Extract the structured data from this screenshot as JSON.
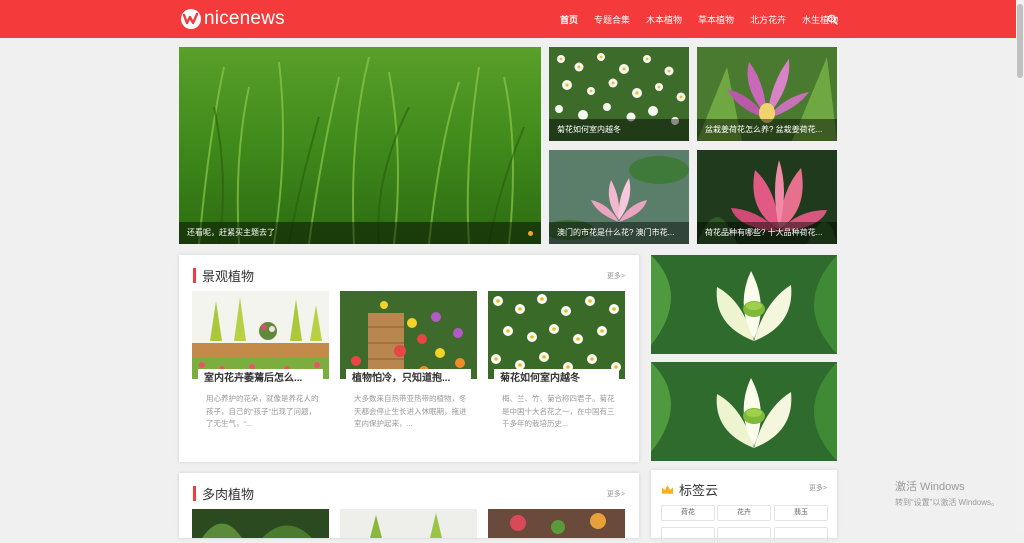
{
  "header": {
    "logo_text": "nicenews",
    "nav": [
      "首页",
      "专题合集",
      "木本植物",
      "草本植物",
      "北方花卉",
      "水生植物"
    ]
  },
  "hero": {
    "main": {
      "caption": "还看呢，赶紧买主题去了"
    },
    "grid": [
      {
        "caption": "菊花如何室内越冬"
      },
      {
        "caption": "盆栽姜荷花怎么养? 盆栽姜荷花..."
      },
      {
        "caption": "澳门的市花是什么花? 澳门市花..."
      },
      {
        "caption": "荷花品种有哪些? 十大品种荷花..."
      }
    ]
  },
  "sections": [
    {
      "title": "景观植物",
      "more": "更多>",
      "articles": [
        {
          "title": "室内花卉萎蔫后怎么...",
          "desc": "用心养护的花朵，就像是养花人的孩子，自己的“孩子”出现了问题，了无生气，“..."
        },
        {
          "title": "植物怕冷，只知道抱...",
          "desc": "大多数来自热带亚热带的植物，冬天都会停止生长进入休眠期，拖进室内保护起来，..."
        },
        {
          "title": "菊花如何室内越冬",
          "desc": "梅、兰、竹、菊合称四君子。菊花是中国十大名花之一，在中国有三千多年的栽培历史..."
        }
      ]
    },
    {
      "title": "多肉植物",
      "more": "更多>"
    }
  ],
  "tag_cloud": {
    "title": "标签云",
    "more": "更多>",
    "tags": [
      "荷花",
      "花卉",
      "翡玉"
    ]
  },
  "watermark": {
    "line1": "激活 Windows",
    "line2": "转到“设置”以激活 Windows。"
  }
}
